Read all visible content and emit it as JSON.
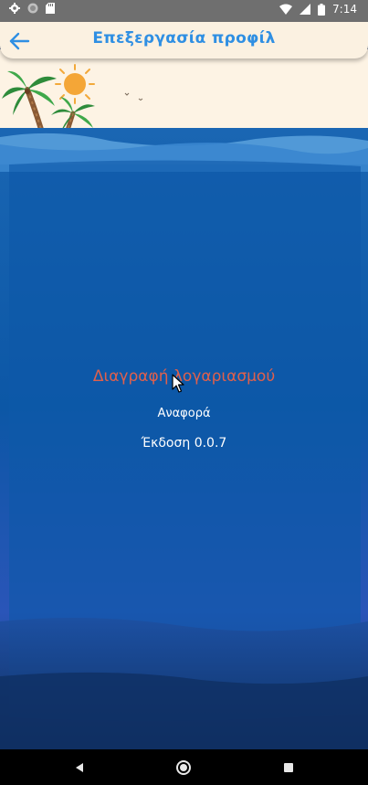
{
  "status_bar": {
    "time": "7:14",
    "icons_left": [
      "gear-icon",
      "circle-app-icon",
      "sd-card-icon"
    ],
    "icons_right": [
      "wifi-icon",
      "signal-icon",
      "battery-icon"
    ]
  },
  "app_bar": {
    "title": "Επεξεργασία προφίλ",
    "back_icon": "arrow-back-icon",
    "accent_color": "#2f8fe3"
  },
  "main": {
    "delete_account_label": "Διαγραφή λογαριασμού",
    "report_label": "Αναφορά",
    "version_label": "Έκδοση 0.0.7",
    "delete_color": "#e0604c"
  },
  "nav_bar": {
    "icons": [
      "back-triangle-icon",
      "home-circle-icon",
      "recents-square-icon"
    ]
  }
}
